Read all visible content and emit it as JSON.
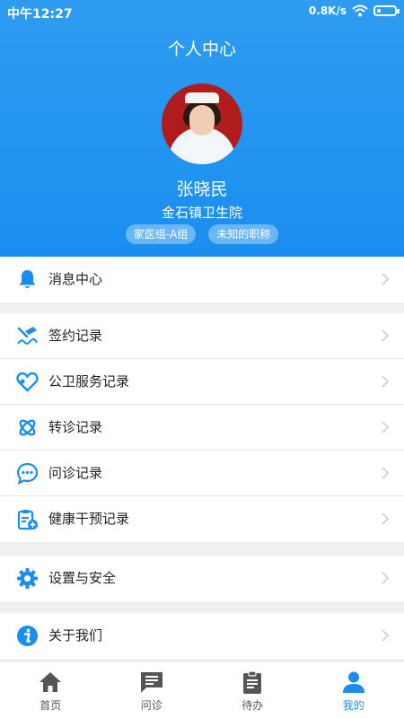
{
  "status_bar": {
    "time": "中午12:27",
    "network": "0.8K/s"
  },
  "header": {
    "title": "个人中心",
    "name": "张晓民",
    "organization": "金石镇卫生院",
    "tags": [
      "家医组-A组",
      "未知的职称"
    ]
  },
  "menu": {
    "group1": [
      {
        "label": "消息中心",
        "icon": "bell-icon"
      }
    ],
    "group2": [
      {
        "label": "签约记录",
        "icon": "signature-icon"
      },
      {
        "label": "公卫服务记录",
        "icon": "heart-icon"
      },
      {
        "label": "转诊记录",
        "icon": "referral-icon"
      },
      {
        "label": "问诊记录",
        "icon": "chat-icon"
      },
      {
        "label": "健康干预记录",
        "icon": "clipboard-plus-icon"
      }
    ],
    "group3": [
      {
        "label": "设置与安全",
        "icon": "gear-icon"
      }
    ],
    "group4": [
      {
        "label": "关于我们",
        "icon": "info-icon"
      }
    ]
  },
  "tabbar": {
    "items": [
      {
        "label": "首页",
        "icon": "home-icon"
      },
      {
        "label": "问诊",
        "icon": "message-icon"
      },
      {
        "label": "待办",
        "icon": "clipboard-icon"
      },
      {
        "label": "我的",
        "icon": "person-icon"
      }
    ],
    "active_index": 3
  },
  "colors": {
    "primary": "#1a8ef0",
    "inactive_tab": "#555555",
    "background": "#f0f0f0"
  }
}
